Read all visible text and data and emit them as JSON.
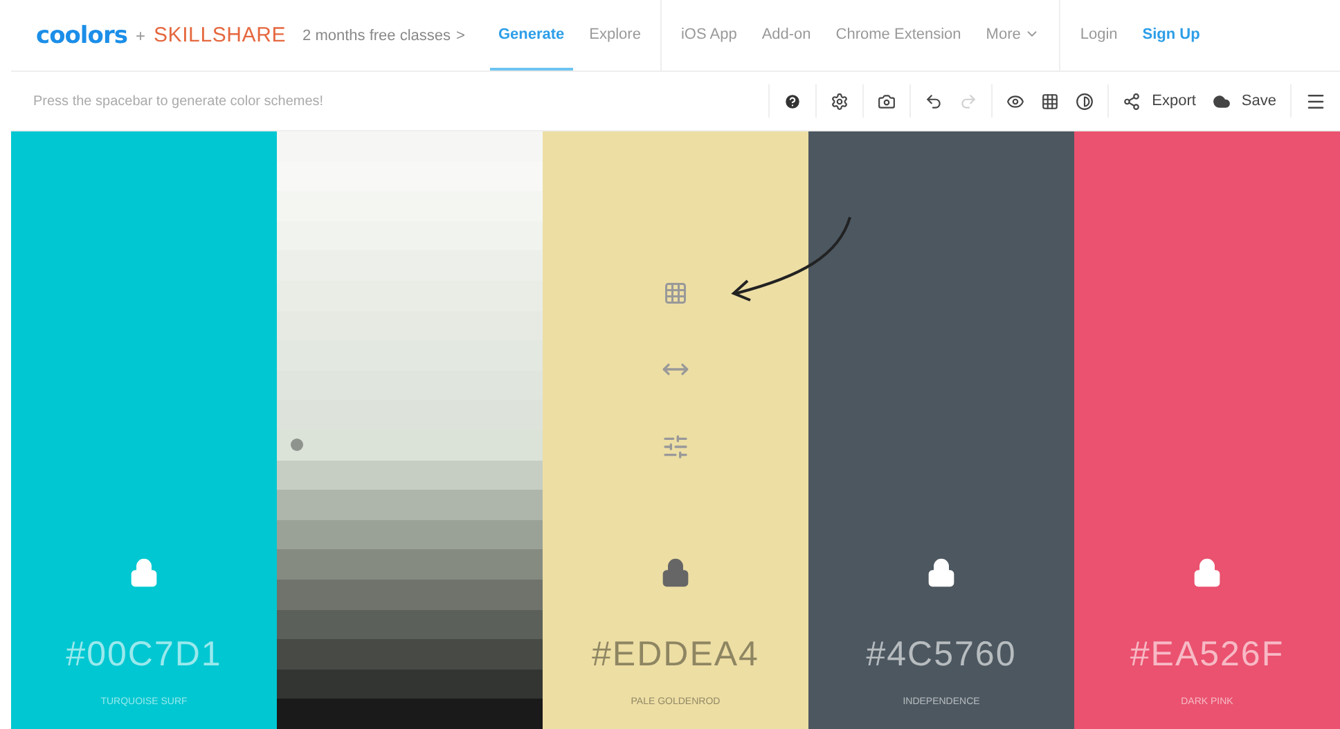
{
  "header": {
    "logo": "coolors",
    "plus": "+",
    "partner": "SKILLSHARE",
    "promo": "2 months free classes",
    "promo_arrow": ">",
    "nav_groups": [
      [
        {
          "label": "Generate",
          "selected": true
        },
        {
          "label": "Explore",
          "selected": false
        }
      ],
      [
        {
          "label": "iOS App",
          "selected": false
        },
        {
          "label": "Add-on",
          "selected": false
        },
        {
          "label": "Chrome Extension",
          "selected": false
        },
        {
          "label": "More",
          "selected": false,
          "dropdown": true
        }
      ],
      [
        {
          "label": "Login",
          "selected": false,
          "kind": "plain"
        },
        {
          "label": "Sign Up",
          "selected": false,
          "kind": "accent"
        }
      ]
    ]
  },
  "toolbar": {
    "hint": "Press the spacebar to generate color schemes!",
    "redo_disabled": true,
    "export": "Export",
    "save": "Save"
  },
  "columns": [
    {
      "kind": "color",
      "color": "#00c7d1",
      "hex": "#00C7D1",
      "name": "TURQUOISE SURF",
      "selected": false
    },
    {
      "kind": "shades",
      "shades": [
        {
          "color": "#f6f7f5",
          "selected": false
        },
        {
          "color": "#f8f9f7",
          "selected": false
        },
        {
          "color": "#f4f6f2",
          "selected": false
        },
        {
          "color": "#f0f3ee",
          "selected": false
        },
        {
          "color": "#edf0ea",
          "selected": false
        },
        {
          "color": "#e9ede6",
          "selected": false
        },
        {
          "color": "#e6eae3",
          "selected": false
        },
        {
          "color": "#e3e8e0",
          "selected": false
        },
        {
          "color": "#e0e5dd",
          "selected": false
        },
        {
          "color": "#dde3da",
          "selected": false
        },
        {
          "color": "#dbe2d8",
          "selected": true
        },
        {
          "color": "#c6cec3",
          "selected": false
        },
        {
          "color": "#aeb6ab",
          "selected": false
        },
        {
          "color": "#9aa297",
          "selected": false
        },
        {
          "color": "#868b82",
          "selected": false
        },
        {
          "color": "#6f736c",
          "selected": false
        },
        {
          "color": "#5c605a",
          "selected": false
        },
        {
          "color": "#474a45",
          "selected": false
        },
        {
          "color": "#333532",
          "selected": false
        },
        {
          "color": "#1a1a1a",
          "selected": false
        }
      ]
    },
    {
      "kind": "color",
      "color": "#eddea4",
      "hex": "#EDDEA4",
      "name": "PALE GOLDENROD",
      "selected": true
    },
    {
      "kind": "color",
      "color": "#4c5760",
      "hex": "#4C5760",
      "name": "INDEPENDENCE",
      "selected": false
    },
    {
      "kind": "color",
      "color": "#ea526f",
      "hex": "#EA526F",
      "name": "DARK PINK",
      "selected": false
    }
  ]
}
